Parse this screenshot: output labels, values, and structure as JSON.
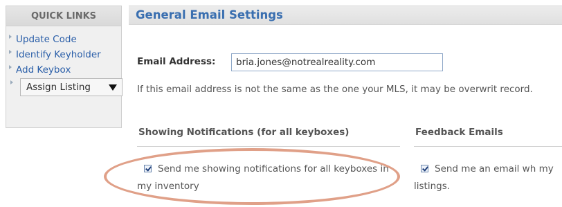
{
  "quick_links": {
    "title": "QUICK LINKS",
    "items": [
      "Update Code",
      "Identify Keyholder",
      "Add Keybox"
    ],
    "select_value": "Assign Listing"
  },
  "main": {
    "title": "General Email Settings",
    "email_label": "Email Address:",
    "email_value": "bria.jones@notrealreality.com",
    "note": "If this email address is not the same as the one your MLS, it may be overwrit record.",
    "showing": {
      "heading": "Showing Notifications (for all keyboxes)",
      "checkbox_text": "Send me showing notifications for all keyboxes in my inventory"
    },
    "feedback": {
      "heading": "Feedback Emails",
      "checkbox_text": "Send me an email wh my listings."
    }
  },
  "colors": {
    "link": "#2a5ea8",
    "title": "#3a6fb0",
    "highlight_ellipse": "#e0a088"
  }
}
